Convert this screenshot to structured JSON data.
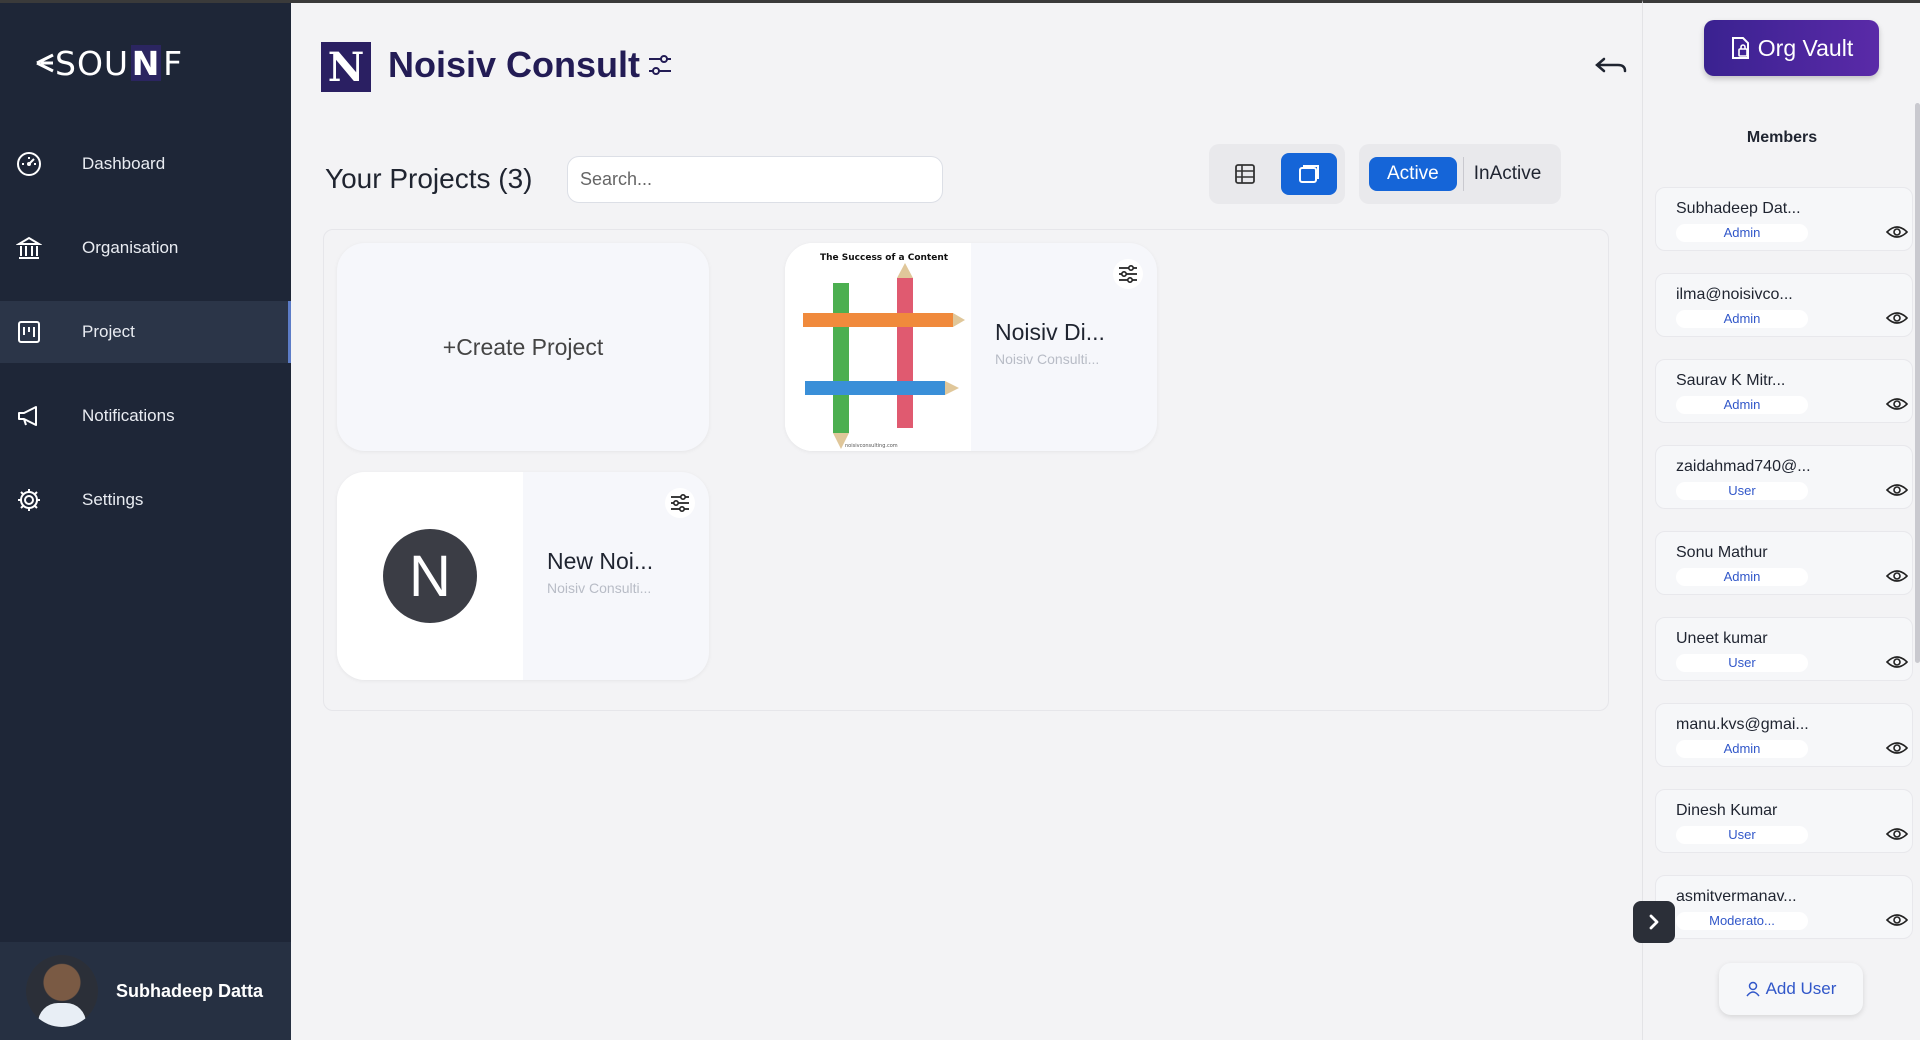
{
  "sidebar": {
    "brand": {
      "pre": "SOU",
      "mid": "N",
      "post": "F"
    },
    "items": [
      {
        "label": "Dashboard",
        "icon": "dashboard-icon"
      },
      {
        "label": "Organisation",
        "icon": "bank-icon"
      },
      {
        "label": "Project",
        "icon": "board-icon",
        "active": true
      },
      {
        "label": "Notifications",
        "icon": "megaphone-icon"
      },
      {
        "label": "Settings",
        "icon": "gear-icon"
      }
    ],
    "user": {
      "name": "Subhadeep Datta"
    }
  },
  "header": {
    "org_logo_letter": "N",
    "org_title": "Noisiv Consult"
  },
  "toolbar": {
    "projects_title": "Your Projects (3)",
    "search_placeholder": "Search...",
    "status_active": "Active",
    "status_inactive": "InActive"
  },
  "projects": {
    "create_label": "+Create Project",
    "cards": [
      {
        "name": "Noisiv Di...",
        "subtitle": "Noisiv Consulti...",
        "thumb": "image"
      },
      {
        "name": "New Noi...",
        "subtitle": "Noisiv Consulti...",
        "thumb_letter": "N"
      }
    ],
    "thumb_image_texts": {
      "title": "The Success of a Content",
      "footer": "noisivconsulting.com"
    }
  },
  "right_panel": {
    "vault_label": "Org Vault",
    "members_title": "Members",
    "members": [
      {
        "name": "Subhadeep Dat...",
        "role": "Admin"
      },
      {
        "name": "ilma@noisivco...",
        "role": "Admin"
      },
      {
        "name": "Saurav K Mitr...",
        "role": "Admin"
      },
      {
        "name": "zaidahmad740@...",
        "role": "User"
      },
      {
        "name": "Sonu Mathur",
        "role": "Admin"
      },
      {
        "name": "Uneet kumar",
        "role": "User"
      },
      {
        "name": "manu.kvs@gmai...",
        "role": "Admin"
      },
      {
        "name": "Dinesh Kumar",
        "role": "User"
      },
      {
        "name": "asmitvermanav...",
        "role": "Moderato..."
      }
    ],
    "add_user_label": "Add User"
  },
  "colors": {
    "sidebar_bg": "#1e2637",
    "accent_blue": "#1565d8",
    "brand_purple": "#2a1f62",
    "vault_gradient": "#4b27a0"
  }
}
